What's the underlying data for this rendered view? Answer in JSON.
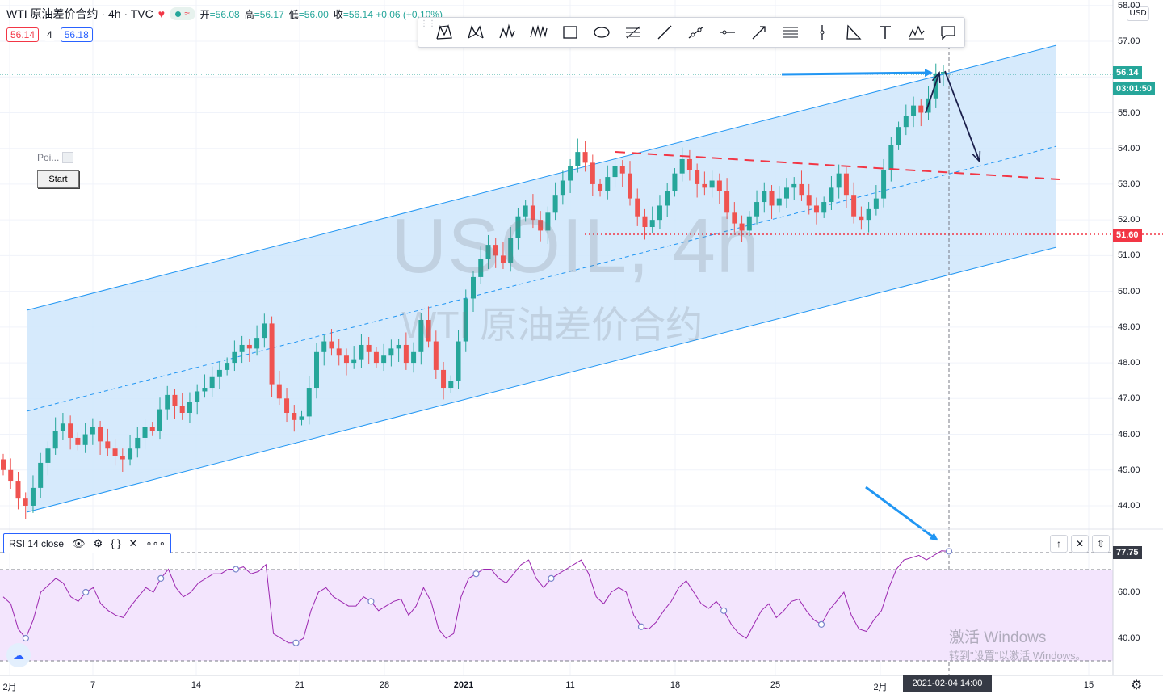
{
  "header": {
    "title": "WTI 原油差价合约 · 4h · TVC",
    "ohlc": [
      {
        "label": "开",
        "value": "=56.08"
      },
      {
        "label": "高",
        "value": "=56.17"
      },
      {
        "label": "低",
        "value": "=56.00"
      },
      {
        "label": "收",
        "value": "=56.14 +0.06 (+0.10%)"
      }
    ],
    "bid": "56.14",
    "spread": "4",
    "ask": "56.18",
    "currency": "USD"
  },
  "poi_label": "Poi...",
  "start_button": "Start",
  "watermark": {
    "symbol": "USOIL, 4h",
    "name": "WTI 原油差价合约"
  },
  "windows_notice": {
    "line1": "激活 Windows",
    "line2": "转到\"设置\"以激活 Windows。"
  },
  "rsi_legend": {
    "label": "RSI 14 close"
  },
  "price_axis": {
    "labels": [
      "58.00",
      "57.00",
      "55.00",
      "54.00",
      "53.00",
      "52.00",
      "51.00",
      "50.00",
      "49.00",
      "48.00",
      "47.00",
      "46.00",
      "45.00",
      "44.00"
    ],
    "current_price": "56.14",
    "countdown": "03:01:50",
    "support_level": "51.60"
  },
  "rsi_axis": {
    "labels": [
      "60.00",
      "40.00"
    ],
    "current": "77.75"
  },
  "time_axis": {
    "labels": [
      "2月",
      "7",
      "14",
      "21",
      "28",
      "2021",
      "11",
      "18",
      "25",
      "2月",
      "15"
    ],
    "crosshair": "2021-02-04  14:00"
  },
  "colors": {
    "up": "#26a69a",
    "down": "#ef5350",
    "channel": "#2196f3",
    "channel_fill": "#cfe6fb",
    "support": "#f23645",
    "rsi": "#9c27b0",
    "rsi_band": "#f3e5fd",
    "dark_arrow": "#1a1f4b"
  },
  "chart_data": {
    "type": "candlestick",
    "symbol": "USOIL",
    "timeframe": "4h",
    "current_price": 56.14,
    "support_level": 51.6,
    "channel": {
      "lower": [
        [
          44.05,
          0
        ],
        [
          51.2,
          1
        ]
      ],
      "upper": [
        [
          49.55,
          0
        ],
        [
          56.9,
          1
        ]
      ]
    },
    "closes": [
      45.0,
      44.7,
      44.2,
      44.0,
      44.5,
      45.2,
      45.6,
      46.1,
      46.3,
      45.9,
      45.7,
      46.0,
      46.2,
      45.8,
      45.6,
      45.4,
      45.3,
      45.6,
      45.9,
      46.2,
      46.1,
      46.7,
      47.1,
      46.8,
      46.6,
      46.9,
      47.2,
      47.3,
      47.6,
      47.8,
      48.0,
      48.3,
      48.5,
      48.4,
      48.7,
      49.1,
      47.4,
      47.0,
      46.6,
      46.4,
      46.5,
      47.3,
      48.3,
      48.6,
      48.4,
      48.2,
      48.0,
      48.1,
      48.5,
      48.3,
      48.0,
      48.2,
      48.4,
      48.5,
      48.0,
      48.3,
      49.2,
      48.6,
      47.8,
      47.3,
      47.5,
      48.6,
      49.8,
      50.4,
      50.9,
      51.3,
      51.0,
      50.8,
      51.5,
      52.1,
      52.4,
      52.0,
      51.7,
      52.2,
      52.7,
      53.1,
      53.5,
      53.9,
      53.6,
      53.0,
      52.8,
      53.2,
      53.5,
      53.3,
      52.6,
      52.1,
      51.8,
      52.0,
      52.4,
      52.8,
      53.3,
      53.7,
      53.4,
      53.0,
      52.9,
      53.1,
      52.8,
      52.2,
      51.9,
      51.7,
      52.1,
      52.5,
      52.8,
      52.4,
      52.6,
      52.9,
      53.0,
      52.7,
      52.4,
      52.2,
      52.5,
      52.9,
      53.3,
      52.7,
      52.1,
      52.0,
      52.3,
      52.6,
      53.4,
      54.1,
      54.6,
      54.9,
      55.2,
      55.0,
      55.4,
      56.1,
      56.14
    ],
    "rsi": {
      "period": 14,
      "current": 77.75,
      "levels": [
        70,
        30
      ],
      "values": [
        58,
        55,
        44,
        40,
        48,
        60,
        63,
        66,
        64,
        58,
        56,
        60,
        62,
        55,
        52,
        50,
        49,
        54,
        58,
        62,
        60,
        66,
        70,
        62,
        58,
        60,
        64,
        66,
        68,
        68,
        70,
        70,
        71,
        68,
        69,
        72,
        42,
        40,
        38,
        38,
        40,
        52,
        60,
        62,
        58,
        56,
        54,
        54,
        58,
        56,
        52,
        54,
        56,
        57,
        50,
        54,
        62,
        56,
        44,
        40,
        42,
        58,
        66,
        68,
        70,
        70,
        66,
        64,
        68,
        72,
        74,
        66,
        62,
        66,
        68,
        70,
        72,
        74,
        68,
        58,
        55,
        60,
        62,
        60,
        50,
        45,
        44,
        47,
        52,
        56,
        62,
        65,
        60,
        55,
        53,
        56,
        52,
        46,
        42,
        40,
        46,
        52,
        55,
        49,
        52,
        56,
        57,
        52,
        48,
        46,
        52,
        56,
        60,
        50,
        44,
        43,
        48,
        52,
        62,
        70,
        74,
        75,
        76,
        74,
        76,
        78,
        77.75
      ]
    }
  }
}
